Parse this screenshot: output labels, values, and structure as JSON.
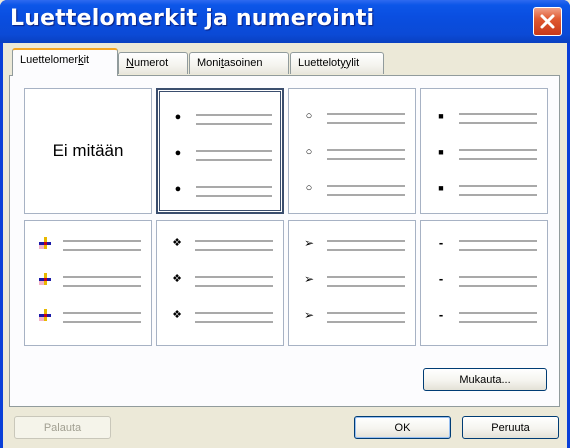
{
  "window": {
    "title": "Luettelomerkit ja numerointi",
    "close_icon": "close-icon"
  },
  "tabs": [
    {
      "label": "Luettelomerkit",
      "underline": "k",
      "active": true
    },
    {
      "label": "Numerot",
      "underline": "N",
      "active": false
    },
    {
      "label": "Monitasoinen",
      "underline": "t",
      "active": false
    },
    {
      "label": "Luettelotyylit",
      "underline": "y",
      "active": false
    }
  ],
  "gallery": {
    "none_label": "Ei mitään",
    "items": [
      {
        "name": "none",
        "selected": false
      },
      {
        "name": "filled-dot",
        "glyph": "●",
        "selected": true
      },
      {
        "name": "hollow-circle",
        "glyph": "○",
        "selected": false
      },
      {
        "name": "filled-square",
        "glyph": "■",
        "selected": false
      },
      {
        "name": "colored-cross",
        "glyph": "",
        "selected": false
      },
      {
        "name": "four-diamond",
        "glyph": "❖",
        "selected": false
      },
      {
        "name": "arrowhead",
        "glyph": "➢",
        "selected": false
      },
      {
        "name": "dash",
        "glyph": "-",
        "selected": false
      }
    ]
  },
  "buttons": {
    "customize": "Mukauta...",
    "reset": "Palauta",
    "ok": "OK",
    "cancel": "Peruuta"
  },
  "colors": {
    "titlebar": "#0a4ee0",
    "close": "#e05a32",
    "tab_accent": "#f5a623"
  }
}
